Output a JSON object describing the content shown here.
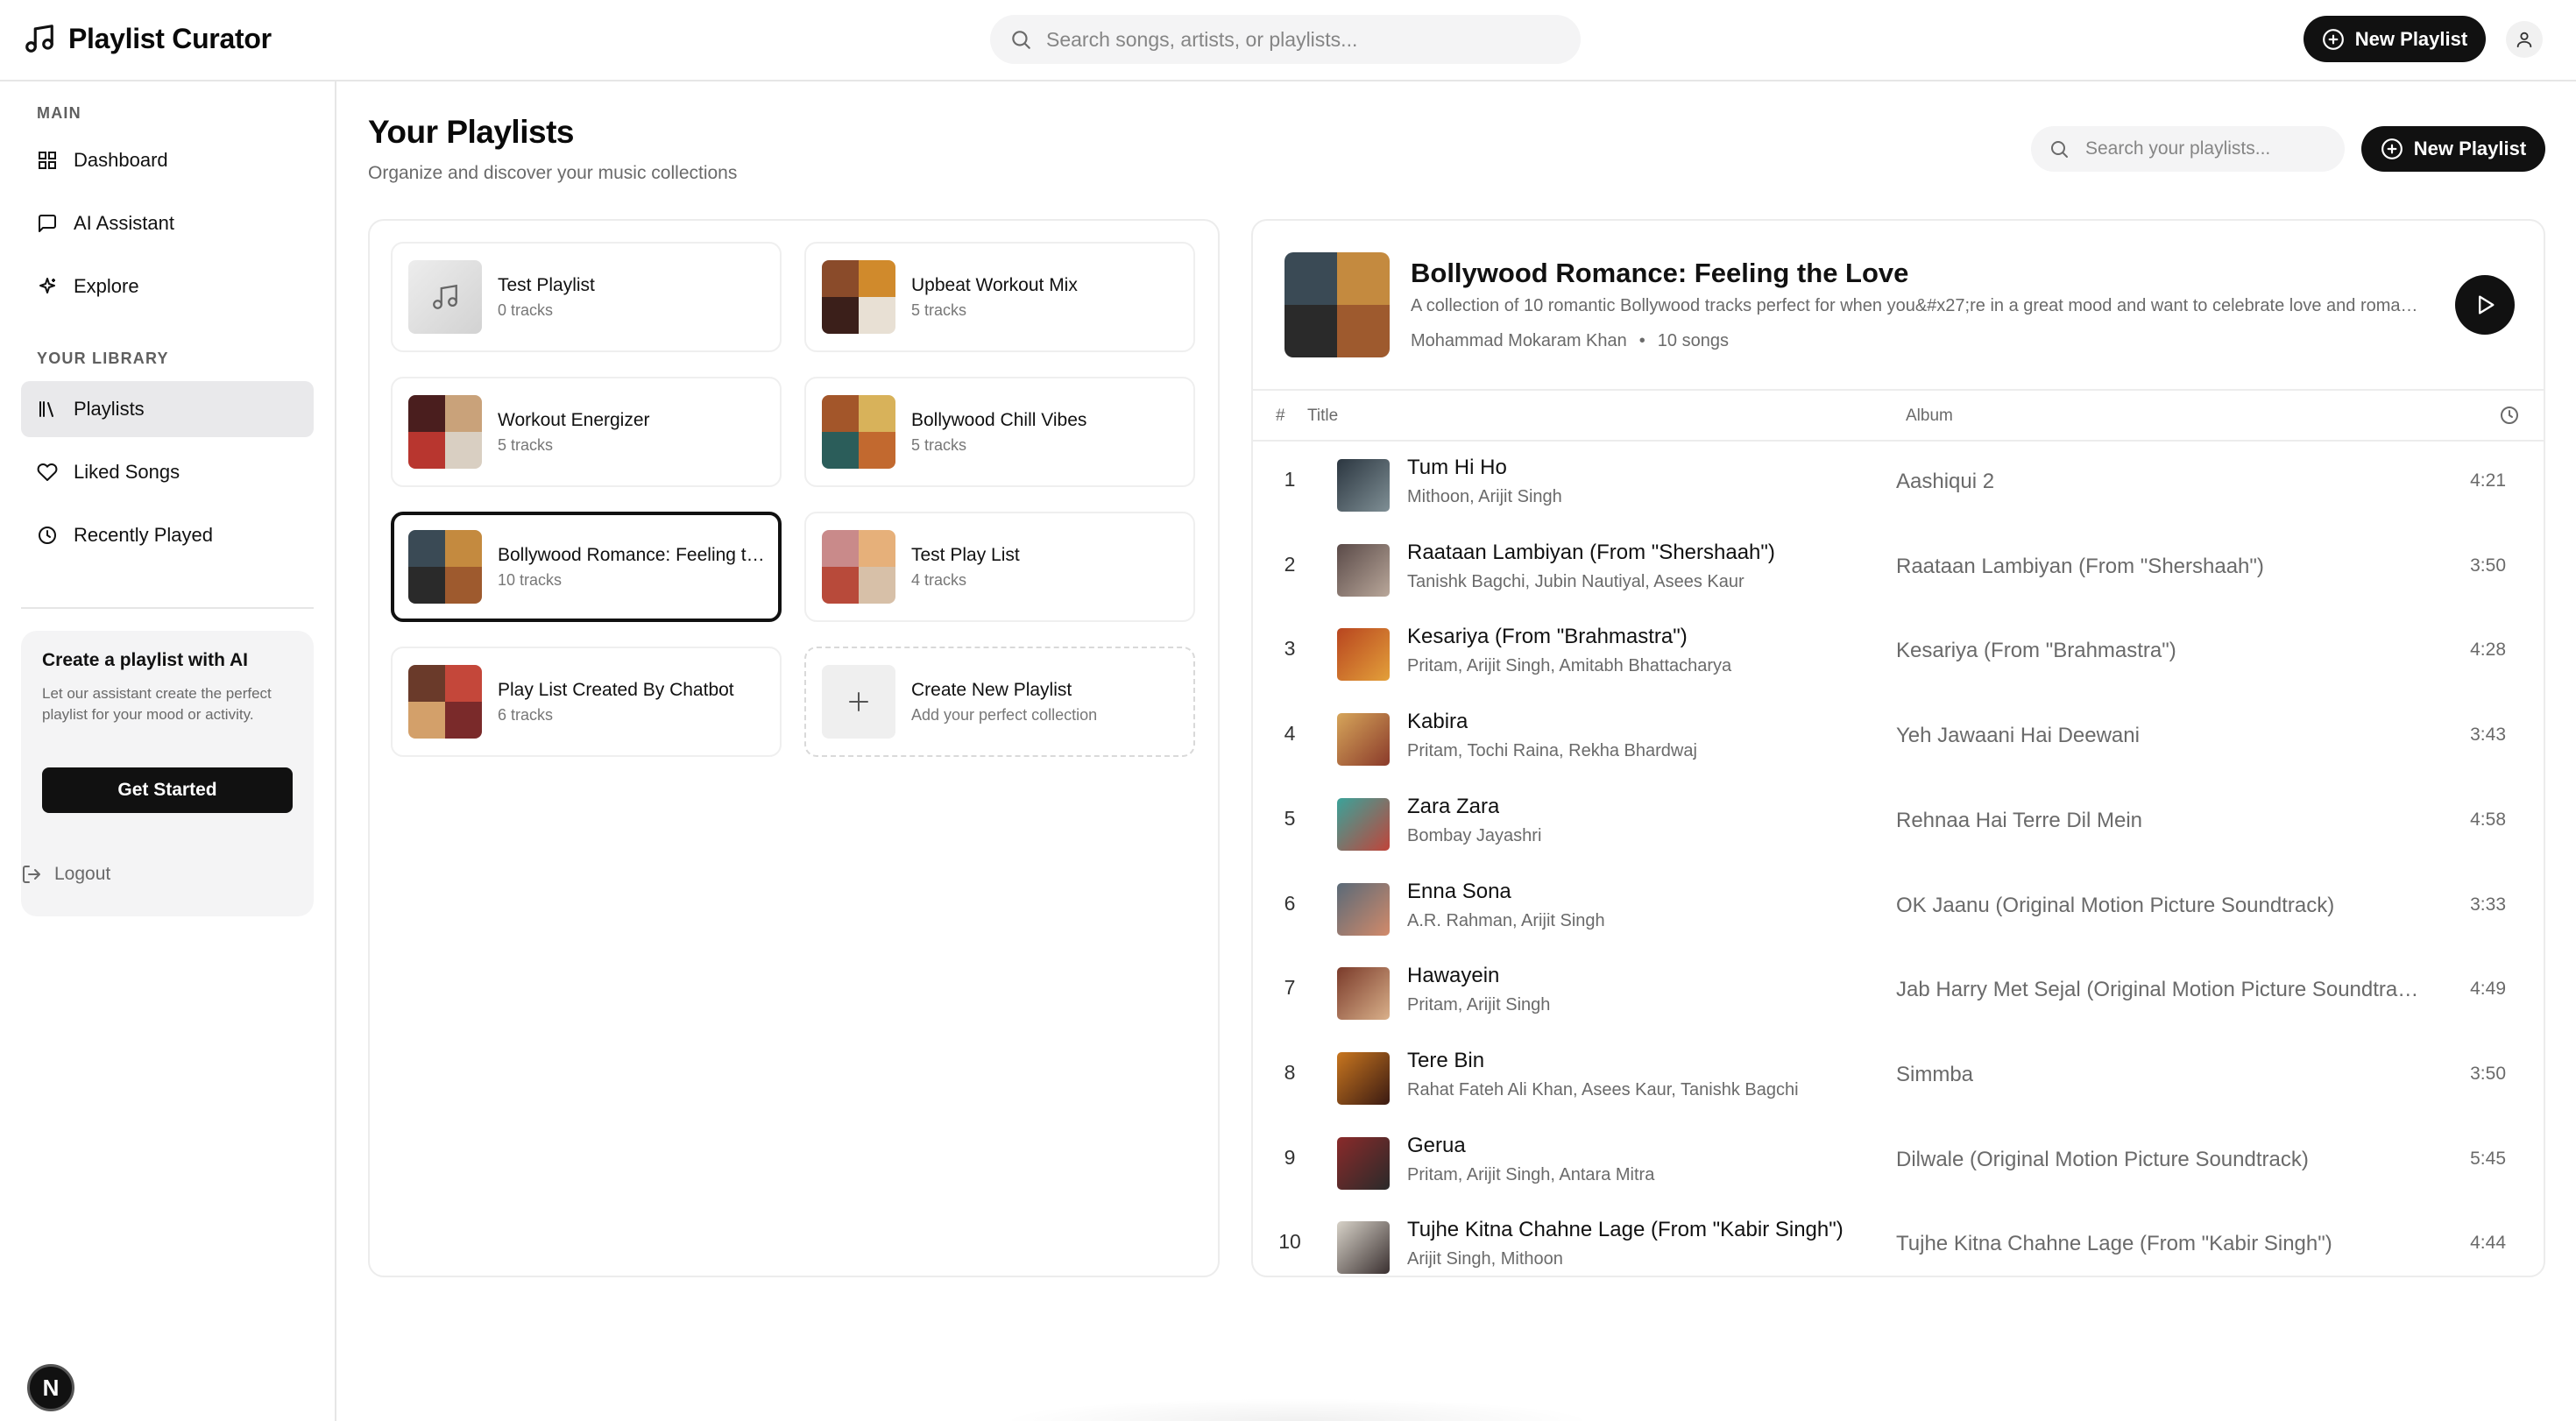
{
  "app": {
    "title": "Playlist Curator",
    "search_placeholder": "Search songs, artists, or playlists...",
    "new_playlist_label": "New Playlist",
    "avatar_icon": "user-icon"
  },
  "sidebar": {
    "main_label": "MAIN",
    "main_items": [
      {
        "label": "Dashboard",
        "icon": "dashboard-icon"
      },
      {
        "label": "AI Assistant",
        "icon": "chat-icon"
      },
      {
        "label": "Explore",
        "icon": "sparkles-icon"
      }
    ],
    "library_label": "YOUR LIBRARY",
    "library_items": [
      {
        "label": "Playlists",
        "icon": "library-icon",
        "active": true
      },
      {
        "label": "Liked Songs",
        "icon": "heart-icon"
      },
      {
        "label": "Recently Played",
        "icon": "clock-icon"
      }
    ],
    "ai_card": {
      "title": "Create a playlist with AI",
      "description": "Let our assistant create the perfect playlist for your mood or activity.",
      "button": "Get Started"
    },
    "logout": "Logout",
    "badge": "N"
  },
  "main": {
    "title": "Your Playlists",
    "subtitle": "Organize and discover your music collections",
    "search_placeholder": "Search your playlists...",
    "new_playlist_label": "New Playlist",
    "playlists": [
      {
        "name": "Test Playlist",
        "count": "0 tracks",
        "thumb": "placeholder"
      },
      {
        "name": "Upbeat Workout Mix",
        "count": "5 tracks",
        "thumb": [
          "#8a4b2a",
          "#d08a2c",
          "#3b1f1a",
          "#e8e0d4"
        ]
      },
      {
        "name": "Workout Energizer",
        "count": "5 tracks",
        "thumb": [
          "#4a1e1e",
          "#c9a27a",
          "#b8362f",
          "#d9cfc2"
        ]
      },
      {
        "name": "Bollywood Chill Vibes",
        "count": "5 tracks",
        "thumb": [
          "#a3562a",
          "#d8b25a",
          "#2b5d5a",
          "#c2692f"
        ]
      },
      {
        "name": "Bollywood Romance: Feeling the Love",
        "count": "10 tracks",
        "thumb": [
          "#3a4a55",
          "#c48a3f",
          "#2a2a2a",
          "#9e5a2e"
        ],
        "selected": true
      },
      {
        "name": "Test Play List",
        "count": "4 tracks",
        "thumb": [
          "#c98a8a",
          "#e6b07a",
          "#b84a3a",
          "#d7c0a8"
        ]
      },
      {
        "name": "Play List Created By Chatbot",
        "count": "6 tracks",
        "thumb": [
          "#6a3a2a",
          "#c4473a",
          "#d3a06a",
          "#7a2a2a"
        ]
      },
      {
        "name": "Create New Playlist",
        "count": "Add your perfect collection",
        "thumb": "plus"
      }
    ],
    "detail": {
      "title": "Bollywood Romance: Feeling the Love",
      "description": "A collection of 10 romantic Bollywood tracks perfect for when you&#x27;re in a great mood and want to celebrate love and romance.",
      "owner": "Mohammad Mokaram Khan",
      "dot": "•",
      "song_count": "10 songs",
      "cover": [
        "#3a4a55",
        "#c48a3f",
        "#2a2a2a",
        "#9e5a2e"
      ],
      "col_num": "#",
      "col_title": "Title",
      "col_album": "Album",
      "tracks": [
        {
          "num": "1",
          "title": "Tum Hi Ho",
          "artists": "Mithoon, Arijit Singh",
          "album": "Aashiqui 2",
          "duration": "4:21",
          "art": [
            "#2b3640",
            "#7f8f95"
          ]
        },
        {
          "num": "2",
          "title": "Raataan Lambiyan (From \"Shershaah\")",
          "artists": "Tanishk Bagchi, Jubin Nautiyal, Asees Kaur",
          "album": "Raataan Lambiyan (From \"Shershaah\")",
          "duration": "3:50",
          "art": [
            "#5a4a48",
            "#b9a79a"
          ]
        },
        {
          "num": "3",
          "title": "Kesariya (From \"Brahmastra\")",
          "artists": "Pritam, Arijit Singh, Amitabh Bhattacharya",
          "album": "Kesariya (From \"Brahmastra\")",
          "duration": "4:28",
          "art": [
            "#b8451f",
            "#e3a03a"
          ]
        },
        {
          "num": "4",
          "title": "Kabira",
          "artists": "Pritam, Tochi Raina, Rekha Bhardwaj",
          "album": "Yeh Jawaani Hai Deewani",
          "duration": "3:43",
          "art": [
            "#d6a55a",
            "#8a3a2a"
          ]
        },
        {
          "num": "5",
          "title": "Zara Zara",
          "artists": "Bombay Jayashri",
          "album": "Rehnaa Hai Terre Dil Mein",
          "duration": "4:58",
          "art": [
            "#3aa39a",
            "#c0443a"
          ]
        },
        {
          "num": "6",
          "title": "Enna Sona",
          "artists": "A.R. Rahman, Arijit Singh",
          "album": "OK Jaanu (Original Motion Picture Soundtrack)",
          "duration": "3:33",
          "art": [
            "#5a6a78",
            "#d28a6a"
          ]
        },
        {
          "num": "7",
          "title": "Hawayein",
          "artists": "Pritam, Arijit Singh",
          "album": "Jab Harry Met Sejal (Original Motion Picture Soundtrack)",
          "duration": "4:49",
          "art": [
            "#7a3a2a",
            "#d9b08a"
          ]
        },
        {
          "num": "8",
          "title": "Tere Bin",
          "artists": "Rahat Fateh Ali Khan, Asees Kaur, Tanishk Bagchi",
          "album": "Simmba",
          "duration": "3:50",
          "art": [
            "#c8761f",
            "#3a1a12"
          ]
        },
        {
          "num": "9",
          "title": "Gerua",
          "artists": "Pritam, Arijit Singh, Antara Mitra",
          "album": "Dilwale (Original Motion Picture Soundtrack)",
          "duration": "5:45",
          "art": [
            "#8a2a2a",
            "#2a2a2a"
          ]
        },
        {
          "num": "10",
          "title": "Tujhe Kitna Chahne Lage (From \"Kabir Singh\")",
          "artists": "Arijit Singh, Mithoon",
          "album": "Tujhe Kitna Chahne Lage (From \"Kabir Singh\")",
          "duration": "4:44",
          "art": [
            "#d7d2c8",
            "#3a3030"
          ]
        }
      ]
    }
  }
}
